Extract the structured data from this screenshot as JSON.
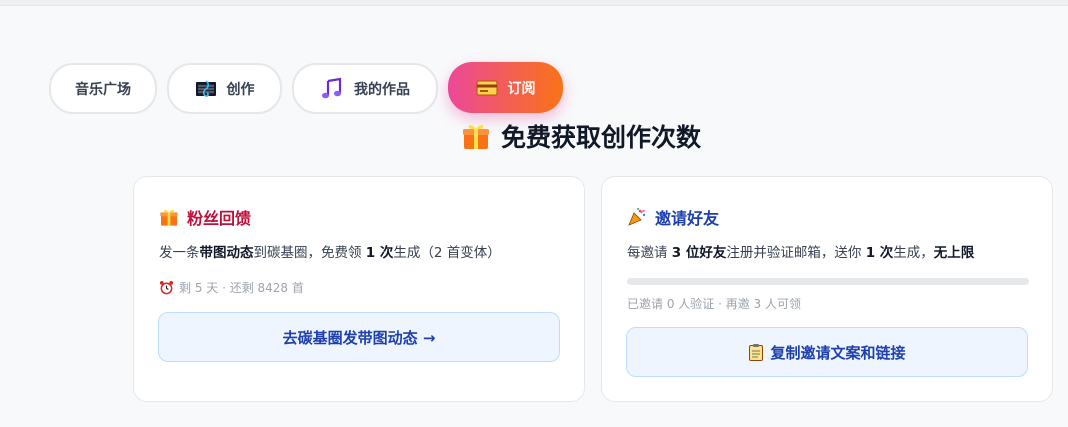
{
  "tabs": [
    {
      "label": "音乐广场",
      "icon": null
    },
    {
      "label": "创作",
      "icon": "music-clef-icon"
    },
    {
      "label": "我的作品",
      "icon": "music-note-icon"
    },
    {
      "label": "订阅",
      "icon": "card-icon",
      "active": true
    }
  ],
  "section": {
    "title": "免费获取创作次数",
    "icon": "gift-icon"
  },
  "fans_card": {
    "title": "粉丝回馈",
    "icon": "gift-icon",
    "desc_p1": "发一条",
    "desc_b1": "带图动态",
    "desc_p2": "到碳基圈，免费领",
    "desc_b2": "1 次",
    "desc_p3": "生成（2 首变体）",
    "meta": "剩 5 天 · 还剩 8428 首",
    "meta_icon": "alarm-clock-icon",
    "button_label": "去碳基圈发带图动态 →"
  },
  "invite_card": {
    "title": "邀请好友",
    "icon": "party-popper-icon",
    "desc_p1": "每邀请",
    "desc_b1": "3 位好友",
    "desc_p2": "注册并验证邮箱，送你",
    "desc_b2": "1 次",
    "desc_p3": "生成，",
    "desc_b3": "无上限",
    "progress": 0,
    "meta": "已邀请 0 人验证 · 再邀 3 人可领",
    "button_label": "复制邀请文案和链接",
    "button_icon": "clipboard-icon"
  },
  "colors": {
    "accent_gradient_start": "#ec4899",
    "accent_gradient_end": "#f97316",
    "fans_title": "#be123c",
    "invite_title": "#1e40af"
  }
}
